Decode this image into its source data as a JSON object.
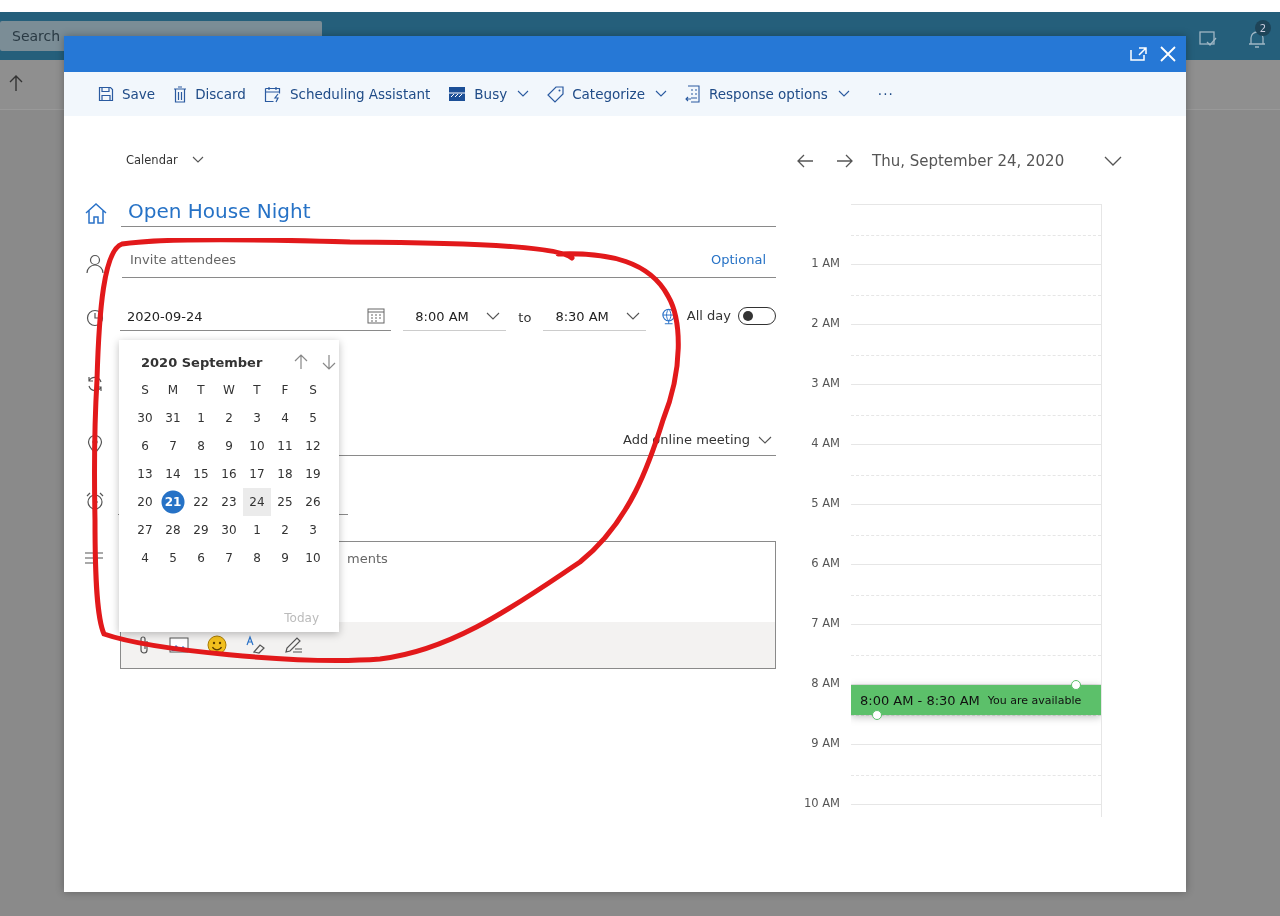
{
  "background": {
    "search": {
      "placeholder": "Search"
    },
    "notification_count": "2"
  },
  "toolbar": [
    {
      "label": "Save",
      "kind": "save",
      "dropdown": false
    },
    {
      "label": "Discard",
      "kind": "discard",
      "dropdown": false
    },
    {
      "label": "Scheduling Assistant",
      "kind": "schedule",
      "dropdown": false
    },
    {
      "label": "Busy",
      "kind": "busy",
      "dropdown": true
    },
    {
      "label": "Categorize",
      "kind": "tag",
      "dropdown": true
    },
    {
      "label": "Response options",
      "kind": "response",
      "dropdown": true
    }
  ],
  "more_label": "···",
  "form": {
    "calendar": "Calendar",
    "title": "Open House Night",
    "attendees": {
      "placeholder": "Invite attendees",
      "optional_link": "Optional"
    },
    "date": "2020-09-24",
    "start_time": "8:00 AM",
    "to_label": "to",
    "end_time": "8:30 AM",
    "all_day": {
      "label": "All day",
      "on": false
    },
    "online_meeting": "Add online meeting",
    "body_visible_text": "ments"
  },
  "date_picker": {
    "month_title": "2020 September",
    "weekdays": [
      "S",
      "M",
      "T",
      "W",
      "T",
      "F",
      "S"
    ],
    "weeks": [
      [
        {
          "day": "30",
          "selected": false,
          "today": false
        },
        {
          "day": "31",
          "selected": false,
          "today": false
        },
        {
          "day": "1",
          "selected": false,
          "today": false
        },
        {
          "day": "2",
          "selected": false,
          "today": false
        },
        {
          "day": "3",
          "selected": false,
          "today": false
        },
        {
          "day": "4",
          "selected": false,
          "today": false
        },
        {
          "day": "5",
          "selected": false,
          "today": false
        }
      ],
      [
        {
          "day": "6",
          "selected": false,
          "today": false
        },
        {
          "day": "7",
          "selected": false,
          "today": false
        },
        {
          "day": "8",
          "selected": false,
          "today": false
        },
        {
          "day": "9",
          "selected": false,
          "today": false
        },
        {
          "day": "10",
          "selected": false,
          "today": false
        },
        {
          "day": "11",
          "selected": false,
          "today": false
        },
        {
          "day": "12",
          "selected": false,
          "today": false
        }
      ],
      [
        {
          "day": "13",
          "selected": false,
          "today": false
        },
        {
          "day": "14",
          "selected": false,
          "today": false
        },
        {
          "day": "15",
          "selected": false,
          "today": false
        },
        {
          "day": "16",
          "selected": false,
          "today": false
        },
        {
          "day": "17",
          "selected": false,
          "today": false
        },
        {
          "day": "18",
          "selected": false,
          "today": false
        },
        {
          "day": "19",
          "selected": false,
          "today": false
        }
      ],
      [
        {
          "day": "20",
          "selected": false,
          "today": false
        },
        {
          "day": "21",
          "selected": false,
          "today": true
        },
        {
          "day": "22",
          "selected": false,
          "today": false
        },
        {
          "day": "23",
          "selected": false,
          "today": false
        },
        {
          "day": "24",
          "selected": true,
          "today": false
        },
        {
          "day": "25",
          "selected": false,
          "today": false
        },
        {
          "day": "26",
          "selected": false,
          "today": false
        }
      ],
      [
        {
          "day": "27",
          "selected": false,
          "today": false
        },
        {
          "day": "28",
          "selected": false,
          "today": false
        },
        {
          "day": "29",
          "selected": false,
          "today": false
        },
        {
          "day": "30",
          "selected": false,
          "today": false
        },
        {
          "day": "1",
          "selected": false,
          "today": false
        },
        {
          "day": "2",
          "selected": false,
          "today": false
        },
        {
          "day": "3",
          "selected": false,
          "today": false
        }
      ],
      [
        {
          "day": "4",
          "selected": false,
          "today": false
        },
        {
          "day": "5",
          "selected": false,
          "today": false
        },
        {
          "day": "6",
          "selected": false,
          "today": false
        },
        {
          "day": "7",
          "selected": false,
          "today": false
        },
        {
          "day": "8",
          "selected": false,
          "today": false
        },
        {
          "day": "9",
          "selected": false,
          "today": false
        },
        {
          "day": "10",
          "selected": false,
          "today": false
        }
      ]
    ],
    "today_button": {
      "label": "Today",
      "disabled": true
    }
  },
  "day_view": {
    "date_title": "Thu, September 24, 2020",
    "hours": [
      "1 AM",
      "2 AM",
      "3 AM",
      "4 AM",
      "5 AM",
      "6 AM",
      "7 AM",
      "8 AM",
      "9 AM",
      "10 AM"
    ],
    "event": {
      "time": "8:00 AM - 8:30 AM",
      "status": "You are available"
    }
  }
}
